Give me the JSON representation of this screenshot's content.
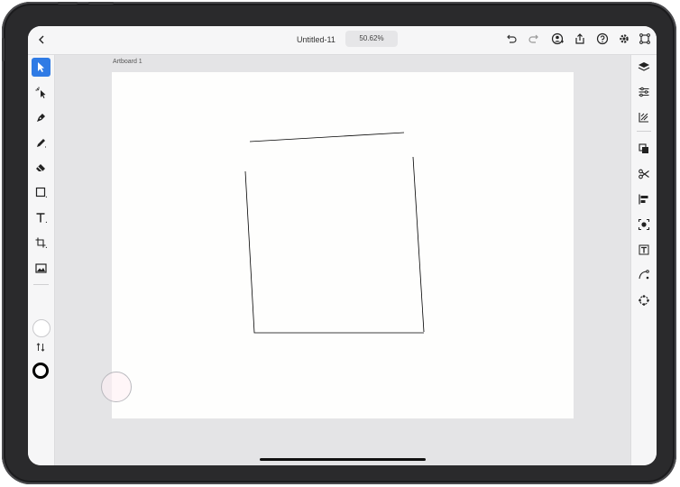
{
  "app": {
    "document_title": "Untitled-11",
    "zoom_level": "50.62%"
  },
  "artboard": {
    "label": "Artboard 1"
  },
  "top_bar": {
    "icons": [
      "chevron-left-icon",
      "undo-icon",
      "redo-icon",
      "invite-user-icon",
      "share-icon",
      "help-icon",
      "gear-icon",
      "crop-artboard-icon"
    ]
  },
  "left_toolbar": {
    "tools": [
      "selection-tool",
      "direct-selection-tool",
      "pen-tool",
      "pencil-tool",
      "eraser-tool",
      "rectangle-tool",
      "type-tool",
      "transform-tool",
      "image-tool"
    ],
    "active_tool": "selection-tool",
    "fill_color": "#ffffff",
    "stroke_color": "#000000"
  },
  "right_panel": {
    "icons": [
      "layers-icon",
      "properties-icon",
      "appearance-icon",
      "path-combine-icon",
      "scissors-icon",
      "align-icon",
      "image-trace-icon",
      "type-properties-icon",
      "curvature-icon",
      "repeat-icon"
    ]
  },
  "colors": {
    "accent": "#2f7be5",
    "canvas_background": "#e4e4e6",
    "artboard": "#fefefd",
    "shape_stroke": "#000000"
  }
}
